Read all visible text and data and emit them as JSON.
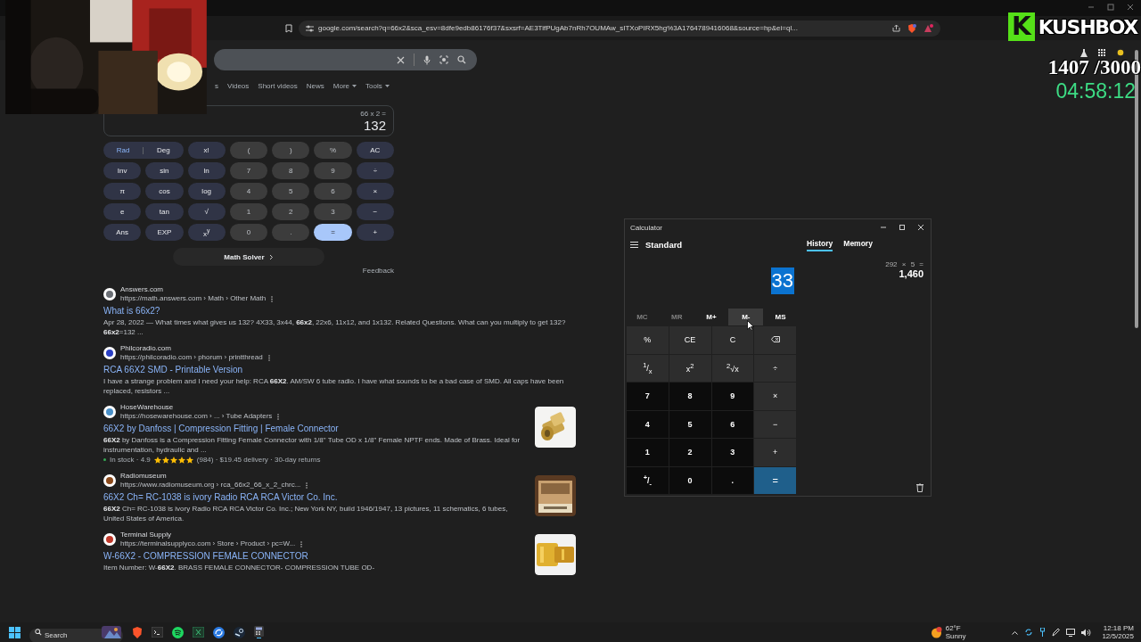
{
  "browser": {
    "url": "google.com/search?q=66x2&sca_esv=8dfe9edb86176f37&sxsrf=AE3TifPUgAb7nRh7OUMAw_sITXoPIRX5hg%3A1764789416068&source=hp&ei=ql..."
  },
  "google": {
    "tabs": [
      {
        "label": "s",
        "selected": false,
        "menu": false
      },
      {
        "label": "Videos",
        "selected": false,
        "menu": false
      },
      {
        "label": "Short videos",
        "selected": false,
        "menu": false
      },
      {
        "label": "News",
        "selected": false,
        "menu": false
      },
      {
        "label": "More",
        "selected": false,
        "menu": true
      },
      {
        "label": "Tools",
        "selected": false,
        "menu": true
      }
    ],
    "calculator": {
      "expression": "66 x 2 =",
      "result": "132",
      "angle_modes": [
        {
          "label": "Rad",
          "selected": true
        },
        {
          "label": "Deg",
          "selected": false
        }
      ],
      "keys": [
        {
          "label": "x!",
          "kind": "fn"
        },
        {
          "label": "(",
          "kind": "num"
        },
        {
          "label": ")",
          "kind": "num"
        },
        {
          "label": "%",
          "kind": "num"
        },
        {
          "label": "AC",
          "kind": "fn"
        },
        {
          "label": "Inv",
          "kind": "fn"
        },
        {
          "label": "sin",
          "kind": "fn"
        },
        {
          "label": "ln",
          "kind": "fn"
        },
        {
          "label": "7",
          "kind": "num"
        },
        {
          "label": "8",
          "kind": "num"
        },
        {
          "label": "9",
          "kind": "num"
        },
        {
          "label": "÷",
          "kind": "fn"
        },
        {
          "label": "π",
          "kind": "fn"
        },
        {
          "label": "cos",
          "kind": "fn"
        },
        {
          "label": "log",
          "kind": "fn"
        },
        {
          "label": "4",
          "kind": "num"
        },
        {
          "label": "5",
          "kind": "num"
        },
        {
          "label": "6",
          "kind": "num"
        },
        {
          "label": "×",
          "kind": "fn"
        },
        {
          "label": "e",
          "kind": "fn"
        },
        {
          "label": "tan",
          "kind": "fn"
        },
        {
          "label": "√",
          "kind": "fn"
        },
        {
          "label": "1",
          "kind": "num"
        },
        {
          "label": "2",
          "kind": "num"
        },
        {
          "label": "3",
          "kind": "num"
        },
        {
          "label": "−",
          "kind": "fn"
        },
        {
          "label": "Ans",
          "kind": "fn"
        },
        {
          "label": "EXP",
          "kind": "fn"
        },
        {
          "label": "x$^{y}$",
          "kind": "fn"
        },
        {
          "label": "0",
          "kind": "num"
        },
        {
          "label": ".",
          "kind": "num"
        },
        {
          "label": "=",
          "kind": "eq"
        },
        {
          "label": "+",
          "kind": "fn"
        }
      ],
      "math_solver": "Math Solver",
      "feedback": "Feedback"
    },
    "results": [
      {
        "site": "Answers.com",
        "url": "https://math.answers.com › Math › Other Math",
        "title": "What is 66x2?",
        "snippet": "Apr 28, 2022 — What times what gives us 132? 4X33, 3x44, **66x2**, 22x6, 11x12, and 1x132. Related Questions. What can you multiply to get 132? **66x2**=132 ...",
        "picture": false
      },
      {
        "site": "Philcoradio.com",
        "url": "https://philcoradio.com › phorum › printthread",
        "title": "RCA 66X2 SMD - Printable Version",
        "snippet": "I have a strange problem and I need your help: RCA **66X2**. AM/SW 6 tube radio. I have what sounds to be a bad case of SMD. All caps have been replaced, resistors ...",
        "picture": false
      },
      {
        "site": "HoseWarehouse",
        "url": "https://hosewarehouse.com › ... › Tube Adapters",
        "title": "66X2 by Danfoss | Compression Fitting | Female Connector",
        "snippet": "**66X2** by Danfoss is a Compression Fitting Female Connector with 1/8\" Tube OD x 1/8\" Female NPTF ends. Made of Brass. Ideal for instrumentation, hydraulic and ...",
        "picture": true,
        "rating": {
          "status": "In stock · 4.9",
          "stars": 5,
          "details": "(984) · $19.45 delivery · 30-day returns"
        }
      },
      {
        "site": "Radiomuseum",
        "url": "https://www.radiomuseum.org › rca_66x2_66_x_2_chrc...",
        "title": "66X2 Ch= RC-1038 is ivory Radio RCA RCA Victor Co. Inc.",
        "snippet": "**66X2** Ch= RC-1038 is ivory Radio RCA RCA Victor Co. Inc.; New York NY, build 1946/1947, 13 pictures, 11 schematics, 6 tubes, United States of America.",
        "picture": true
      },
      {
        "site": "Terminal Supply",
        "url": "https://terminalsupplyco.com › Store › Product › pc=W...",
        "title": "W-66X2 - COMPRESSION FEMALE CONNECTOR",
        "snippet": "Item Number: W-**66X2**. BRASS FEMALE CONNECTOR- COMPRESSION TUBE OD-",
        "picture": true
      }
    ]
  },
  "calculator_app": {
    "title": "Calculator",
    "mode": "Standard",
    "panel_tabs": [
      {
        "label": "History",
        "selected": true
      },
      {
        "label": "Memory",
        "selected": false
      }
    ],
    "display": "33",
    "display_selected": true,
    "memory_keys": [
      {
        "label": "MC",
        "disabled": true,
        "hovered": false
      },
      {
        "label": "MR",
        "disabled": true,
        "hovered": false
      },
      {
        "label": "M+",
        "disabled": false,
        "hovered": false
      },
      {
        "label": "M-",
        "disabled": false,
        "hovered": true
      },
      {
        "label": "MS",
        "disabled": false,
        "hovered": false
      }
    ],
    "keys": [
      {
        "label": "%",
        "kind": "op"
      },
      {
        "label": "CE",
        "kind": "op"
      },
      {
        "label": "C",
        "kind": "op"
      },
      {
        "kind": "backspace"
      },
      {
        "label": "$^{1}$/$_{x}$",
        "kind": "op"
      },
      {
        "label": "x$^{2}$",
        "kind": "op"
      },
      {
        "label": "$^{2}$√x",
        "kind": "op"
      },
      {
        "label": "÷",
        "kind": "op"
      },
      {
        "label": "7",
        "kind": "digit"
      },
      {
        "label": "8",
        "kind": "digit"
      },
      {
        "label": "9",
        "kind": "digit"
      },
      {
        "label": "×",
        "kind": "op"
      },
      {
        "label": "4",
        "kind": "digit"
      },
      {
        "label": "5",
        "kind": "digit"
      },
      {
        "label": "6",
        "kind": "digit"
      },
      {
        "label": "−",
        "kind": "op"
      },
      {
        "label": "1",
        "kind": "digit"
      },
      {
        "label": "2",
        "kind": "digit"
      },
      {
        "label": "3",
        "kind": "digit"
      },
      {
        "label": "+",
        "kind": "op"
      },
      {
        "label": "$^{+}$/$_{-}$",
        "kind": "digit"
      },
      {
        "label": "0",
        "kind": "digit"
      },
      {
        "label": ".",
        "kind": "digit"
      },
      {
        "label": "=",
        "kind": "equals"
      }
    ],
    "history": [
      {
        "expression": "292 × 5 =",
        "result": "1,460"
      }
    ]
  },
  "overlay": {
    "logo_mark": "K",
    "brand": "KUSHBOX",
    "count": "1407 /3000",
    "timer": "04:58:12"
  },
  "taskbar": {
    "search_placeholder": "Search",
    "weather": {
      "temperature": "62°F",
      "condition": "Sunny"
    },
    "time": "12:18 PM",
    "date": "12/5/2025"
  }
}
